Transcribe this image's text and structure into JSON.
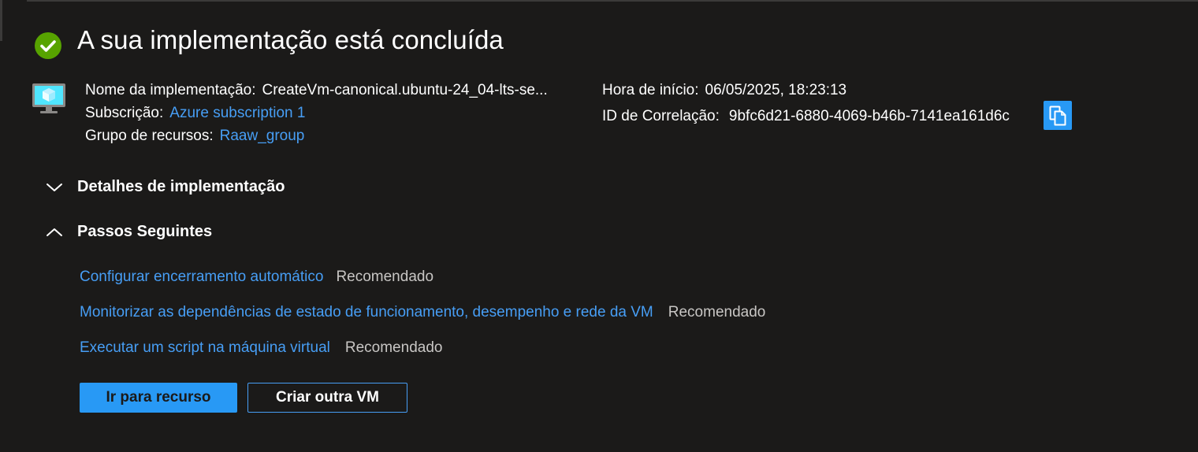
{
  "header": {
    "title": "A sua implementação está concluída",
    "status_icon": "success-check-icon"
  },
  "deployment": {
    "icon": "virtual-machine-icon",
    "name_label": "Nome da implementação:",
    "name_value": "CreateVm-canonical.ubuntu-24_04-lts-se...",
    "subscription_label": "Subscrição:",
    "subscription_value": "Azure subscription 1",
    "resource_group_label": "Grupo de recursos:",
    "resource_group_value": "Raaw_group",
    "start_time_label": "Hora de início:",
    "start_time_value": "06/05/2025, 18:23:13",
    "correlation_label": "ID de Correlação:",
    "correlation_value": "9bfc6d21-6880-4069-b46b-7141ea161d6c",
    "copy_icon": "copy-icon"
  },
  "sections": {
    "details": {
      "label": "Detalhes de implementação",
      "expanded": false
    },
    "next_steps": {
      "label": "Passos Seguintes",
      "expanded": true
    }
  },
  "next_steps": [
    {
      "link": "Configurar encerramento automático",
      "tag": "Recomendado"
    },
    {
      "link": "Monitorizar as dependências de estado de funcionamento, desempenho e rede da VM",
      "tag": "Recomendado"
    },
    {
      "link": "Executar um script na máquina virtual",
      "tag": "Recomendado"
    }
  ],
  "actions": {
    "primary_label": "Ir para recurso",
    "secondary_label": "Criar outra VM"
  },
  "colors": {
    "background": "#1b1a19",
    "link": "#479ef5",
    "accent": "#2899f5",
    "success": "#57a300"
  }
}
